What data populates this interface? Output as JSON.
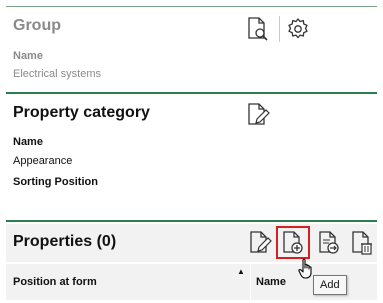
{
  "group": {
    "title": "Group",
    "name_label": "Name",
    "name_value": "Electrical systems"
  },
  "property_category": {
    "title": "Property category",
    "name_label": "Name",
    "name_value": "Appearance",
    "sorting_label": "Sorting Position"
  },
  "properties": {
    "title": "Properties (0)",
    "columns": [
      "Position at form",
      "Name"
    ]
  },
  "tooltip": {
    "text": "Add"
  },
  "colors": {
    "divider": "#2e7d4f",
    "highlight": "#d42020"
  }
}
